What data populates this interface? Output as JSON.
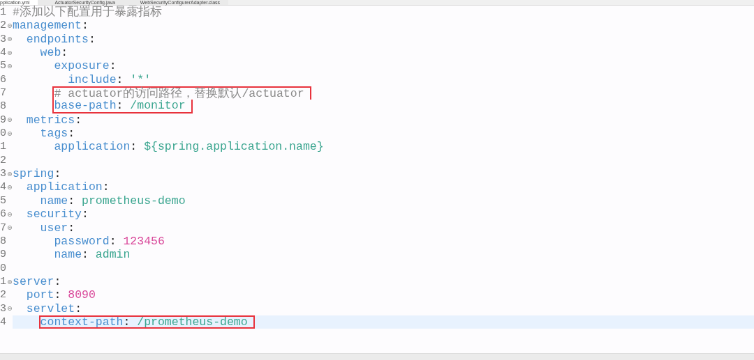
{
  "tabs": [
    {
      "label": "pplication.yml",
      "selected": true
    },
    {
      "label": "ActuatorSecurityConfig.java",
      "selected": false
    },
    {
      "label": "WebSecurityConfigurerAdapter.class",
      "selected": false
    }
  ],
  "lines": [
    {
      "number": "1",
      "fold": false,
      "tokens": [
        {
          "kind": "comment",
          "text": "#添加以下配置用于暴露指标"
        }
      ]
    },
    {
      "number": "2",
      "fold": true,
      "tokens": [
        {
          "kind": "key",
          "text": "management"
        },
        {
          "kind": "colon",
          "text": ":"
        }
      ]
    },
    {
      "number": "3",
      "fold": true,
      "tokens": [
        {
          "kind": "key",
          "text": "  endpoints"
        },
        {
          "kind": "colon",
          "text": ":"
        }
      ]
    },
    {
      "number": "4",
      "fold": true,
      "tokens": [
        {
          "kind": "key",
          "text": "    web"
        },
        {
          "kind": "colon",
          "text": ":"
        }
      ]
    },
    {
      "number": "5",
      "fold": true,
      "tokens": [
        {
          "kind": "key",
          "text": "      exposure"
        },
        {
          "kind": "colon",
          "text": ":"
        }
      ]
    },
    {
      "number": "6",
      "fold": false,
      "tokens": [
        {
          "kind": "key",
          "text": "        include"
        },
        {
          "kind": "colon",
          "text": ":"
        },
        {
          "kind": "string",
          "text": "'*'"
        }
      ]
    },
    {
      "number": "7",
      "fold": false,
      "boxed": true,
      "tokens": [
        {
          "kind": "comment",
          "text": "      # actuator的访问路径，替换默认/actuator"
        }
      ]
    },
    {
      "number": "8",
      "fold": false,
      "boxed": true,
      "tokens": [
        {
          "kind": "key",
          "text": "      base-path"
        },
        {
          "kind": "colon",
          "text": ":"
        },
        {
          "kind": "string",
          "text": "/monitor"
        }
      ]
    },
    {
      "number": "9",
      "fold": true,
      "tokens": [
        {
          "kind": "key",
          "text": "  metrics"
        },
        {
          "kind": "colon",
          "text": ":"
        }
      ]
    },
    {
      "number": "0",
      "fold": true,
      "tokens": [
        {
          "kind": "key",
          "text": "    tags"
        },
        {
          "kind": "colon",
          "text": ":"
        }
      ]
    },
    {
      "number": "1",
      "fold": false,
      "tokens": [
        {
          "kind": "key",
          "text": "      application"
        },
        {
          "kind": "colon",
          "text": ":"
        },
        {
          "kind": "string",
          "text": "${spring.application.name}"
        }
      ]
    },
    {
      "number": "2",
      "fold": false
    },
    {
      "number": "3",
      "fold": true,
      "tokens": [
        {
          "kind": "key",
          "text": "spring"
        },
        {
          "kind": "colon",
          "text": ":"
        }
      ]
    },
    {
      "number": "4",
      "fold": true,
      "tokens": [
        {
          "kind": "key",
          "text": "  application"
        },
        {
          "kind": "colon",
          "text": ":"
        }
      ]
    },
    {
      "number": "5",
      "fold": false,
      "tokens": [
        {
          "kind": "key",
          "text": "    name"
        },
        {
          "kind": "colon",
          "text": ":"
        },
        {
          "kind": "string",
          "text": "prometheus-demo"
        }
      ]
    },
    {
      "number": "6",
      "fold": true,
      "tokens": [
        {
          "kind": "key",
          "text": "  security"
        },
        {
          "kind": "colon",
          "text": ":"
        }
      ]
    },
    {
      "number": "7",
      "fold": true,
      "tokens": [
        {
          "kind": "key",
          "text": "    user"
        },
        {
          "kind": "colon",
          "text": ":"
        }
      ]
    },
    {
      "number": "8",
      "fold": false,
      "tokens": [
        {
          "kind": "key",
          "text": "      password"
        },
        {
          "kind": "colon",
          "text": ":"
        },
        {
          "kind": "number",
          "text": "123456"
        }
      ]
    },
    {
      "number": "9",
      "fold": false,
      "tokens": [
        {
          "kind": "key",
          "text": "      name"
        },
        {
          "kind": "colon",
          "text": ":"
        },
        {
          "kind": "string",
          "text": "admin"
        }
      ]
    },
    {
      "number": "0",
      "fold": false
    },
    {
      "number": "1",
      "fold": true,
      "tokens": [
        {
          "kind": "key",
          "text": "server"
        },
        {
          "kind": "colon",
          "text": ":"
        }
      ]
    },
    {
      "number": "2",
      "fold": false,
      "tokens": [
        {
          "kind": "key",
          "text": "  port"
        },
        {
          "kind": "colon",
          "text": ":"
        },
        {
          "kind": "number",
          "text": "8090"
        }
      ]
    },
    {
      "number": "3",
      "fold": true,
      "tokens": [
        {
          "kind": "key",
          "text": "  servlet"
        },
        {
          "kind": "colon",
          "text": ":"
        }
      ]
    },
    {
      "number": "4",
      "fold": false,
      "current": true,
      "boxed": true,
      "tokens": [
        {
          "kind": "key",
          "text": "    context-path"
        },
        {
          "kind": "colon",
          "text": ":"
        },
        {
          "kind": "string",
          "text": "/prometheus-demo"
        }
      ]
    }
  ]
}
